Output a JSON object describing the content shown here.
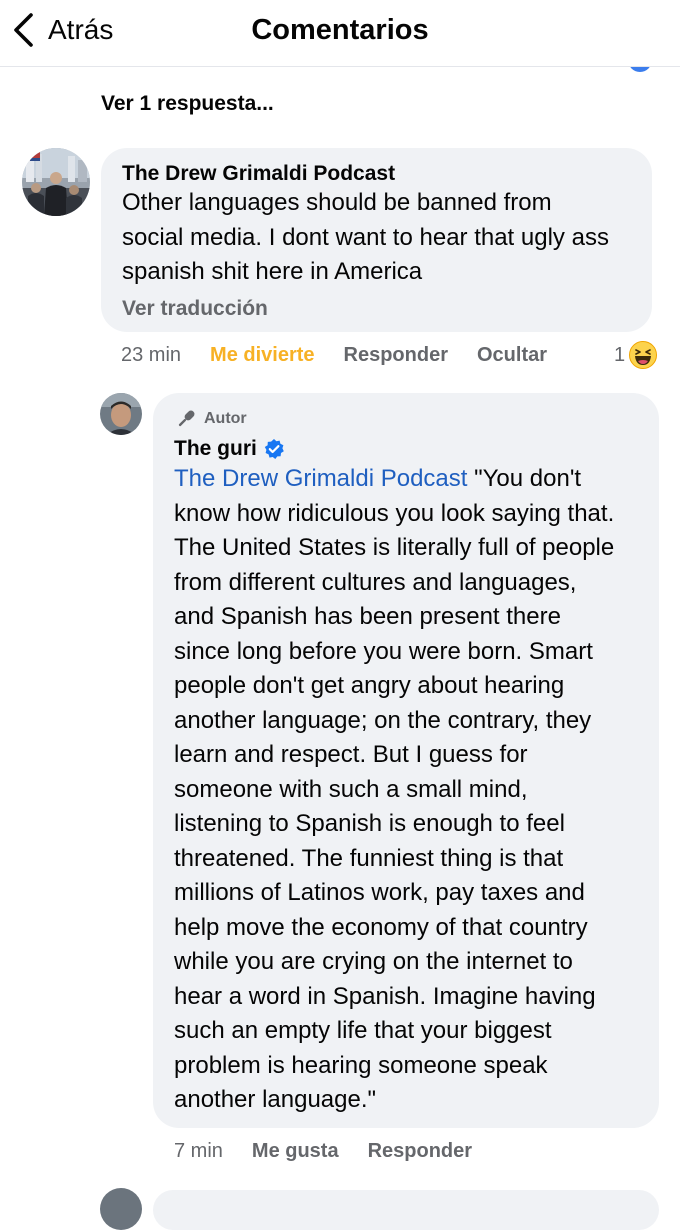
{
  "header": {
    "back_label": "Atrás",
    "title": "Comentarios"
  },
  "thread": {
    "more_replies_label": "Ver 1 respuesta..."
  },
  "comment1": {
    "author": "The Drew Grimaldi Podcast",
    "lines": [
      "Other languages should be banned from",
      "social media. I dont want to hear that ugly ass",
      "spanish shit here in America"
    ],
    "translate_label": "Ver traducción",
    "time": "23 min",
    "reaction_label": "Me divierte",
    "reply_label": "Responder",
    "hide_label": "Ocultar",
    "reaction_count": "1",
    "reaction_icon": "haha-emoji-icon"
  },
  "reply1": {
    "badge_label": "Autor",
    "badge_icon": "microphone-icon",
    "author": "The guri",
    "verified": true,
    "mention": "The Drew Grimaldi Podcast",
    "lines": [
      "\"You don't",
      "know how ridiculous you look saying that.",
      "The United States is literally full of people",
      "from different cultures and languages,",
      "and Spanish has been present there",
      "since long before you were born. Smart",
      "people don't get angry about hearing",
      "another language; on the contrary, they",
      "learn and respect. But I guess for",
      "someone with such a small mind,",
      "listening to Spanish is enough to feel",
      "threatened. The funniest thing is that",
      "millions of Latinos work, pay taxes and",
      "help move the economy of that country",
      "while you are crying on the internet to",
      "hear a word in Spanish. Imagine having",
      "such an empty life that your biggest",
      "problem is hearing someone speak",
      "another language.\""
    ],
    "time": "7 min",
    "like_label": "Me gusta",
    "reply_label": "Responder"
  },
  "colors": {
    "bubble_bg": "#f0f2f5",
    "link_blue": "#1f5fc0",
    "muted_gray": "#65676b",
    "haha_yellow": "#f7b125",
    "verified_blue": "#1877f2"
  }
}
